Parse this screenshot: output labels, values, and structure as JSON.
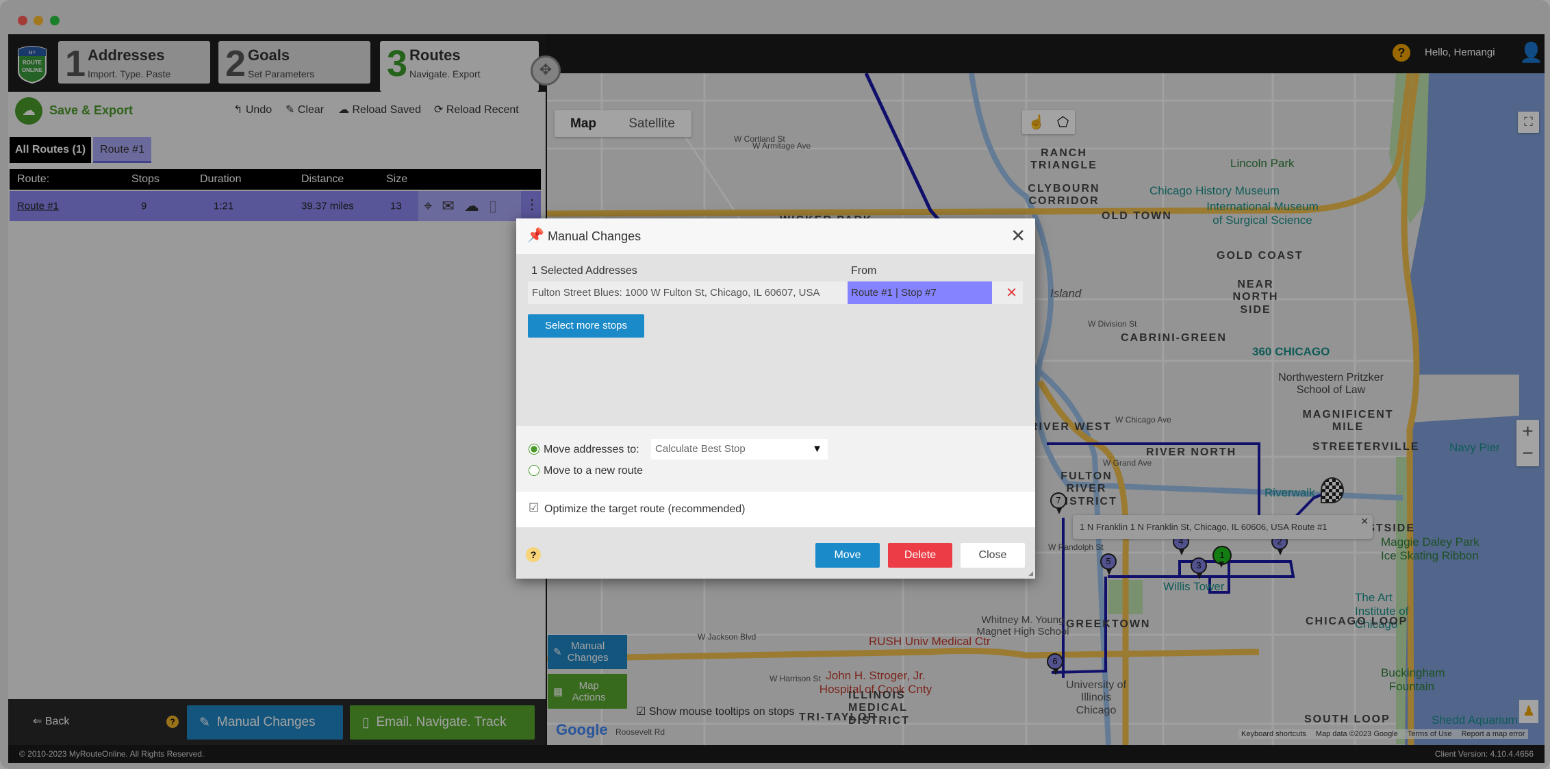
{
  "window": {
    "traffic_lights": [
      "#ff5f57",
      "#febc2e",
      "#28c840"
    ]
  },
  "logo": {
    "text": "MY ROUTE ONLINE"
  },
  "steps": [
    {
      "num": "1",
      "title": "Addresses",
      "sub": "Import. Type. Paste"
    },
    {
      "num": "2",
      "title": "Goals",
      "sub": "Set Parameters"
    },
    {
      "num": "3",
      "title": "Routes",
      "sub": "Navigate. Export"
    }
  ],
  "toolbar": {
    "save_export": "Save & Export",
    "undo": "Undo",
    "clear": "Clear",
    "reload_saved": "Reload Saved",
    "reload_recent": "Reload Recent"
  },
  "route_tabs": [
    "All Routes (1)",
    "Route #1"
  ],
  "table": {
    "headers": [
      "Route:",
      "Stops",
      "Duration",
      "Distance",
      "Size"
    ],
    "rows": [
      {
        "route": "Route #1",
        "stops": "9",
        "duration": "1:21",
        "distance": "39.37 miles",
        "size": "13"
      }
    ]
  },
  "bottom": {
    "back": "Back",
    "help": "?",
    "manual_changes": "Manual Changes",
    "email": "Email. Navigate. Track"
  },
  "footer": {
    "copyright": "© 2010-2023  MyRouteOnline. All Rights Reserved.",
    "version": "Client Version: 4.10.4.4656"
  },
  "header": {
    "help": "?",
    "greeting": "Hello, Hemangi"
  },
  "map": {
    "type_buttons": [
      "Map",
      "Satellite"
    ],
    "side_buttons": {
      "manual": "Manual Changes",
      "actions": "Map Actions"
    },
    "tooltips_checkbox": "Show mouse tooltips on stops",
    "google": "Google",
    "attribution": [
      "Keyboard shortcuts",
      "Map data ©2023 Google",
      "Terms of Use",
      "Report a map error"
    ],
    "zoom_in": "+",
    "zoom_out": "−",
    "tooltip": "1 N Franklin 1 N Franklin St, Chicago, IL 60606, USA Route #1",
    "markers": [
      "7",
      "4",
      "2",
      "1",
      "3",
      "5",
      "6"
    ],
    "route_color": "#1a1aa8",
    "labels": [
      "W Cortland St",
      "RANCH TRIANGLE",
      "CLYBOURN CORRIDOR",
      "WICKER PARK",
      "OLD TOWN",
      "Lincoln Park",
      "Chicago History Museum",
      "International Museum of Surgical Science",
      "GOLD COAST",
      "NEAR NORTH SIDE",
      "CABRINI-GREEN",
      "360 CHICAGO",
      "Northwestern Pritzker School of Law",
      "MAGNIFICENT MILE",
      "STREETERVILLE",
      "Navy Pier",
      "RIVER WEST",
      "RIVER NORTH",
      "FULTON RIVER DISTRICT",
      "Riverwalk",
      "EASTSIDE",
      "Maggie Daley Park Ice Skating Ribbon",
      "Willis Tower",
      "The Art Institute of Chicago",
      "CHICAGO LOOP",
      "GREEKTOWN",
      "Whitney M. Young Magnet High School",
      "RUSH Univ Medical Ctr",
      "John H. Stroger, Jr. Hospital of Cook Cnty",
      "TRI-TAYLOR",
      "ILLINOIS MEDICAL DISTRICT",
      "University of Illinois Chicago",
      "Buckingham Fountain",
      "SOUTH LOOP",
      "Shedd Aquarium",
      "W Jackson Blvd",
      "W Harrison St",
      "Roosevelt Rd",
      "Island",
      "W Armitage Ave",
      "W Division St",
      "W Chicago Ave",
      "W Grand Ave",
      "W Randolph St"
    ]
  },
  "modal": {
    "title": "Manual Changes",
    "selected_header": "1 Selected Addresses",
    "from_header": "From",
    "address": "Fulton Street Blues: 1000 W Fulton St, Chicago, IL 60607, USA",
    "from": "Route #1 | Stop #7",
    "select_more": "Select more stops",
    "move_to_label": "Move addresses to:",
    "move_to_value": "Calculate Best Stop",
    "move_new_route": "Move to a new route",
    "optimize": "Optimize the target route (recommended)",
    "optimize_checked": true,
    "selected_option": "Move addresses to:",
    "help": "?",
    "move": "Move",
    "delete": "Delete",
    "close": "Close"
  }
}
